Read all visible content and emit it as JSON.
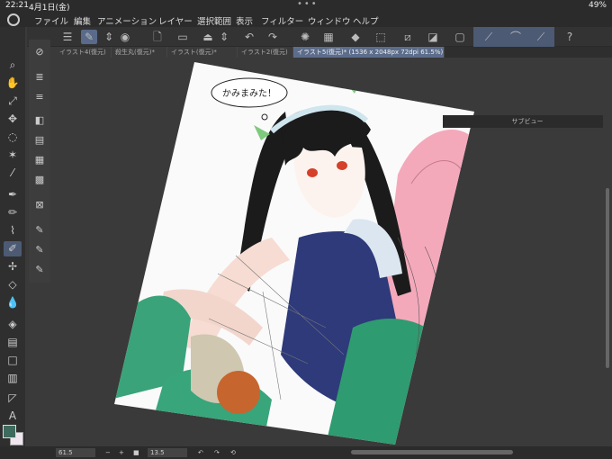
{
  "status": {
    "time": "22:21",
    "date": "4月1日(金)",
    "dots": "•••",
    "battery": "49%"
  },
  "menu": [
    {
      "label": "ファイル",
      "left": 0
    },
    {
      "label": "編集"
    },
    {
      "label": "アニメーション"
    },
    {
      "label": "レイヤー"
    },
    {
      "label": "選択範囲"
    },
    {
      "label": "表示"
    },
    {
      "label": "フィルター"
    },
    {
      "label": "ウィンドウ"
    },
    {
      "label": "ヘルプ"
    }
  ],
  "tabs": [
    {
      "label": "イラスト4(復元)"
    },
    {
      "label": "殺生丸(復元)*"
    },
    {
      "label": "イラスト(復元)*"
    },
    {
      "label": "イラスト2(復元)"
    },
    {
      "label": "イラスト5(復元)* (1536 x 2048px 72dpi 61.5%)"
    }
  ],
  "speech_bubble": "かみまみた！",
  "subview": {
    "label": "サブビュー"
  },
  "bottom": {
    "zoom": "61.5",
    "rotate": "13.5",
    "minus": "−",
    "plus": "+"
  },
  "colors": {
    "foreground": "#3e6b5e",
    "background": "#efe6ef",
    "accent": "#4c5a74"
  }
}
